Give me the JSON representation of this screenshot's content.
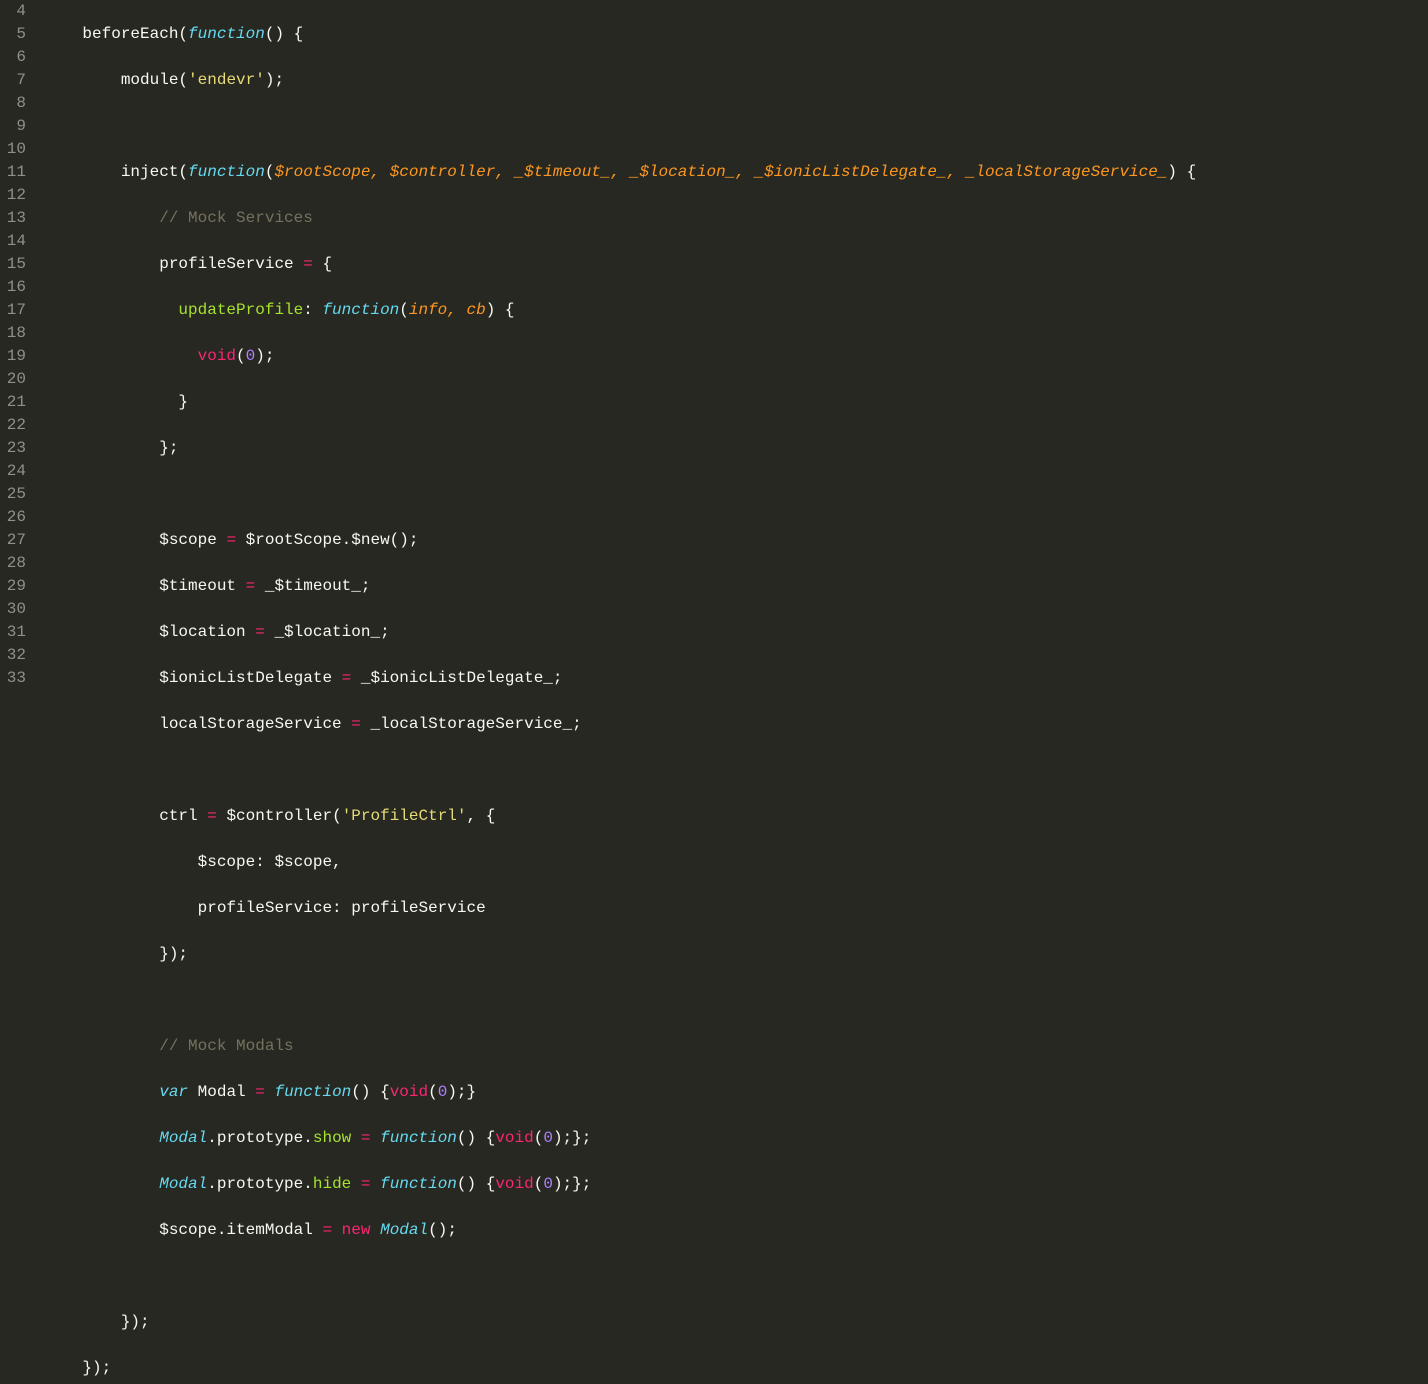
{
  "gutter": {
    "start": 4,
    "end": 33
  },
  "code": {
    "l4": {
      "fn": "beforeEach",
      "p1": "(",
      "kw": "function",
      "p2": "() {"
    },
    "l5": {
      "fn": "module",
      "p1": "(",
      "str": "'endevr'",
      "p2": ");"
    },
    "l7": {
      "fn": "inject",
      "p1": "(",
      "kw": "function",
      "p2": "(",
      "args": "$rootScope, $controller, _$timeout_, _$location_, _$ionicListDelegate_, _localStorageService_",
      "p3": ") {"
    },
    "l8": {
      "cmt": "// Mock Services"
    },
    "l9": {
      "t": "profileService ",
      "op": "=",
      "t2": " {"
    },
    "l10": {
      "key": "updateProfile",
      "t": ": ",
      "kw": "function",
      "p1": "(",
      "args": "info, cb",
      "p2": ") {"
    },
    "l11": {
      "kw": "void",
      "p1": "(",
      "num": "0",
      "p2": ");"
    },
    "l12": {
      "t": "}"
    },
    "l13": {
      "t": "};"
    },
    "l15": {
      "t1": "$scope ",
      "op": "=",
      "t2": " $rootScope.",
      "fn": "$new",
      "p2": "();"
    },
    "l16": {
      "t1": "$timeout ",
      "op": "=",
      "t2": " _$timeout_;"
    },
    "l17": {
      "t1": "$location ",
      "op": "=",
      "t2": " _$location_;"
    },
    "l18": {
      "t1": "$ionicListDelegate ",
      "op": "=",
      "t2": " _$ionicListDelegate_;"
    },
    "l19": {
      "t1": "localStorageService ",
      "op": "=",
      "t2": " _localStorageService_;"
    },
    "l21": {
      "t1": "ctrl ",
      "op": "=",
      "t2": " ",
      "fn": "$controller",
      "p1": "(",
      "str": "'ProfileCtrl'",
      "p2": ", {"
    },
    "l22": {
      "key": "$scope",
      "t": ": $scope,"
    },
    "l23": {
      "key": "profileService",
      "t": ": profileService"
    },
    "l24": {
      "t": "});"
    },
    "l26": {
      "cmt": "// Mock Modals"
    },
    "l27": {
      "kw1": "var",
      "t1": " Modal ",
      "op": "=",
      "t2": " ",
      "kw2": "function",
      "p1": "() {",
      "v": "void",
      "p2": "(",
      "num": "0",
      "p3": ");}"
    },
    "l28": {
      "obj": "Modal",
      "t1": ".prototype.",
      "prop": "show",
      "t2": " ",
      "op": "=",
      "t3": " ",
      "kw": "function",
      "p1": "() {",
      "v": "void",
      "p2": "(",
      "num": "0",
      "p3": ");};"
    },
    "l29": {
      "obj": "Modal",
      "t1": ".prototype.",
      "prop": "hide",
      "t2": " ",
      "op": "=",
      "t3": " ",
      "kw": "function",
      "p1": "() {",
      "v": "void",
      "p2": "(",
      "num": "0",
      "p3": ");};"
    },
    "l30": {
      "t1": "$scope.itemModal ",
      "op": "=",
      "t2": " ",
      "kw": "new",
      "t3": " ",
      "fn": "Modal",
      "p2": "();"
    },
    "l32": {
      "t": "});"
    },
    "l33": {
      "t": "});"
    }
  }
}
